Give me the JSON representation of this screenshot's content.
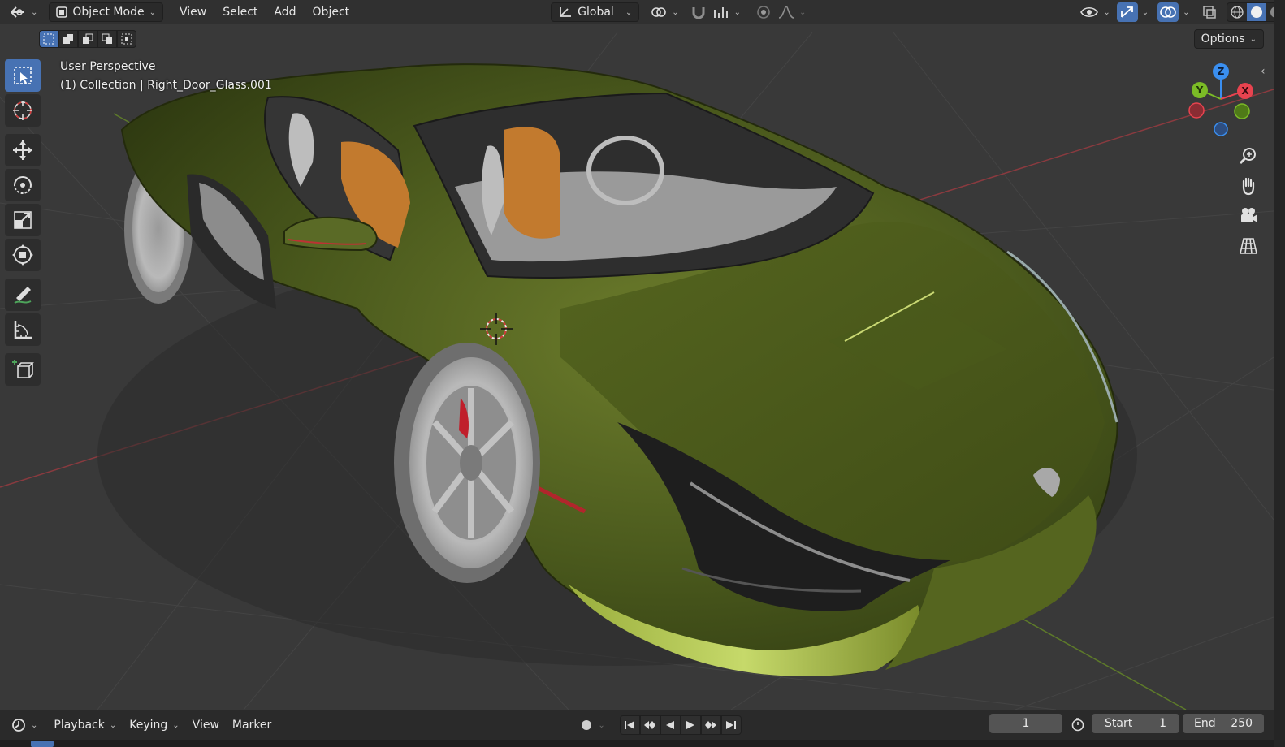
{
  "header": {
    "mode": "Object Mode",
    "menus": [
      "View",
      "Select",
      "Add",
      "Object"
    ],
    "orientation": "Global",
    "options_label": "Options"
  },
  "viewport": {
    "view_name": "User Perspective",
    "object_info": "(1) Collection | Right_Door_Glass.001"
  },
  "gizmo": {
    "x": "X",
    "y": "Y",
    "z": "Z"
  },
  "timeline": {
    "menus": [
      "Playback",
      "Keying",
      "View",
      "Marker"
    ],
    "current_frame": "1",
    "start_label": "Start",
    "start_value": "1",
    "end_label": "End",
    "end_value": "250"
  },
  "colors": {
    "accent": "#4772b3",
    "axis_x": "#e8434f",
    "axis_y": "#7bbb26",
    "axis_z": "#3a8ff0",
    "car_body": "#5a6a26"
  },
  "icons": {
    "editor_type": "cursor-editor-icon",
    "mode": "object-mode-icon",
    "transform": "transform-orientation-icon",
    "pivot": "pivot-point-icon",
    "snap": "snap-magnet-icon",
    "snap_increment": "snap-increment-icon",
    "proportional": "proportional-edit-icon",
    "falloff": "falloff-curve-icon",
    "visibility": "eye-icon",
    "gizmo_toggle": "gizmo-arrows-icon",
    "overlays": "overlay-circles-icon",
    "xray": "xray-icon",
    "shading": [
      "wireframe-icon",
      "solid-icon",
      "material-icon",
      "rendered-icon"
    ],
    "tools": [
      "select-box-icon",
      "cursor-icon",
      "move-icon",
      "rotate-icon",
      "scale-icon",
      "transform-icon",
      "annotate-icon",
      "measure-icon",
      "add-cube-icon"
    ],
    "nav": [
      "zoom-icon",
      "hand-pan-icon",
      "camera-icon",
      "grid-view-icon"
    ]
  }
}
